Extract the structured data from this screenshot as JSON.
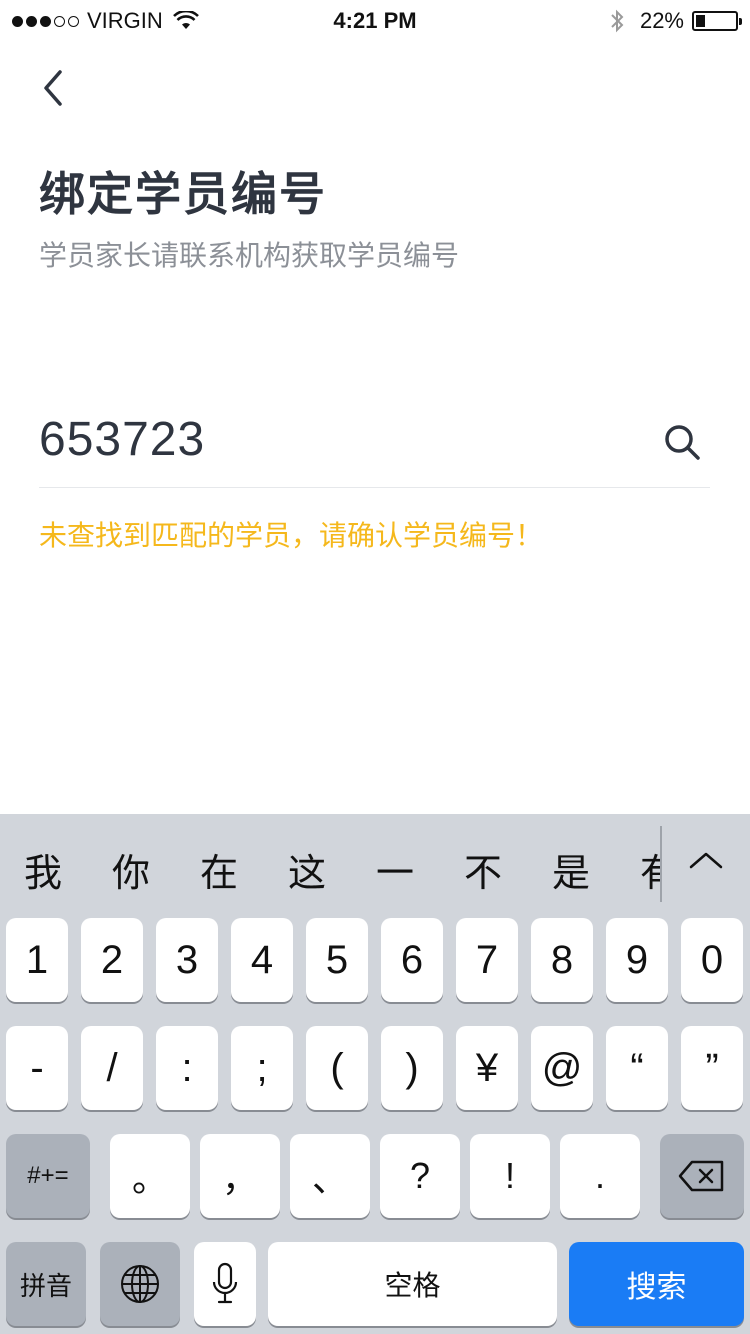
{
  "status": {
    "carrier": "VIRGIN",
    "time": "4:21 PM",
    "battery": "22%",
    "battery_level": 0.22,
    "signal_bars": 3,
    "icons": [
      "wifi-icon",
      "bluetooth-icon",
      "battery-icon"
    ]
  },
  "header": {
    "back_icon": "chevron-left-icon",
    "title": "绑定学员编号",
    "subtitle": "学员家长请联系机构获取学员编号"
  },
  "form": {
    "student_id_value": "653723",
    "search_icon": "search-icon",
    "error_message": "未查找到匹配的学员，请确认学员编号！"
  },
  "colors": {
    "title": "#2f3540",
    "subtitle": "#8c9097",
    "error": "#f5b81c",
    "keyboard_bg": "#d1d5db",
    "search_key": "#1a7cf5"
  },
  "keyboard": {
    "candidates": [
      "我",
      "你",
      "在",
      "这",
      "一",
      "不",
      "是",
      "有"
    ],
    "expand_icon": "chevron-up-icon",
    "row1": [
      "1",
      "2",
      "3",
      "4",
      "5",
      "6",
      "7",
      "8",
      "9",
      "0"
    ],
    "row2": [
      "-",
      "/",
      ":",
      ";",
      "(",
      ")",
      "¥",
      "@",
      "“",
      "”"
    ],
    "row3": {
      "mode": "#+=",
      "keys": [
        "。",
        "，",
        "、",
        "?",
        "!",
        "."
      ],
      "delete_icon": "backspace-icon"
    },
    "row4": {
      "pinyin": "拼音",
      "globe_icon": "globe-icon",
      "mic_icon": "microphone-icon",
      "space": "空格",
      "search": "搜索"
    }
  }
}
